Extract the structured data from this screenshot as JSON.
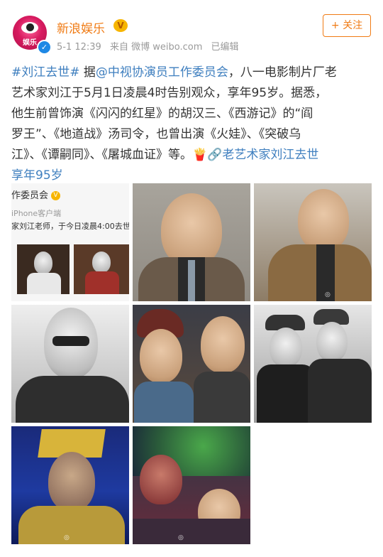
{
  "account": {
    "name": "新浪娱乐",
    "avatar_text": "娱乐",
    "meta_time": "5-1 12:39",
    "meta_source": "来自 微博 weibo.com",
    "meta_edited": "已编辑",
    "follow_label": "+ 关注",
    "vip_badge": "V"
  },
  "post": {
    "line1": {
      "hashtag": "#刘江去世#",
      "part1": " 据",
      "mention": "@中视协演员工作委员会",
      "part2": "，八一电影制片厂老"
    },
    "line2": "艺术家刘江于5月1日凌晨4时告别观众，享年95岁。据悉，",
    "line3": "他生前曾饰演《闪闪的红星》的胡汉三、《西游记》的“阎",
    "line4": "罗王”、《地道战》汤司令，也曾出演《火娃》、《突破乌",
    "line5": {
      "text": "江》、《谭嗣同》、《屠城血证》等。",
      "fire_icon": "🍟",
      "link_icon": "🔗",
      "link_text": "老艺术家刘江去世"
    },
    "line6": "享年95岁"
  },
  "screenshot_image": {
    "title": "作委员会",
    "badge": "V",
    "sub": "iPhone客户端",
    "text": "家刘江老师，于今日凌晨4:00去世"
  },
  "images": [
    {
      "name": "photo-1"
    },
    {
      "name": "photo-2"
    },
    {
      "name": "photo-3"
    },
    {
      "name": "photo-4"
    },
    {
      "name": "photo-5"
    },
    {
      "name": "photo-6"
    },
    {
      "name": "photo-7"
    },
    {
      "name": "photo-8"
    }
  ],
  "colors": {
    "accent": "#f07b14",
    "link": "#3f7fbf",
    "text": "#333333",
    "meta": "#9a9a9a"
  }
}
